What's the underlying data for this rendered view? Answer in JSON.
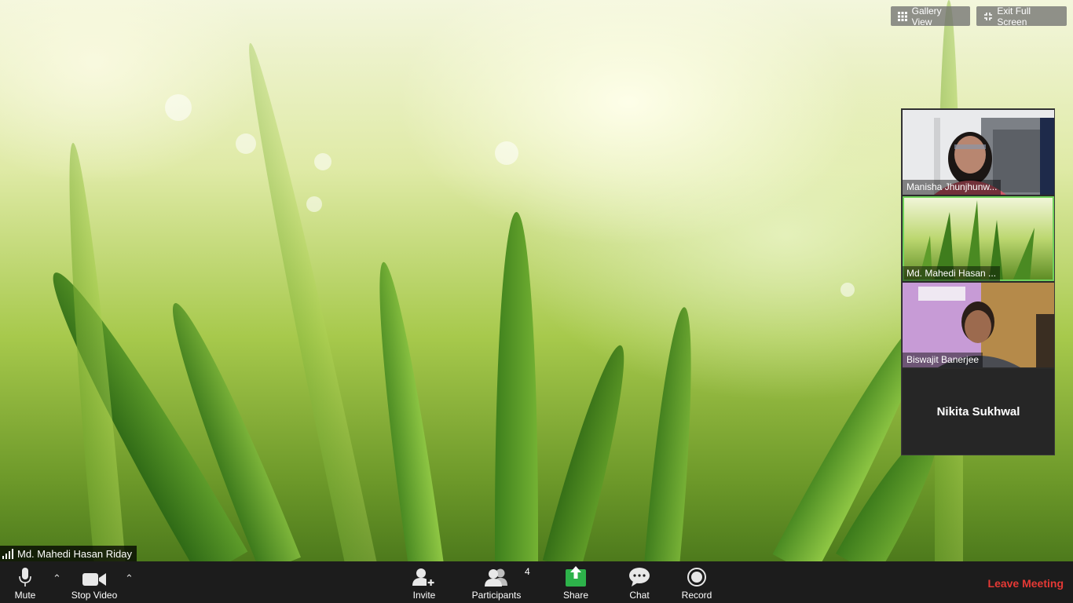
{
  "top_buttons": {
    "gallery_view": "Gallery View",
    "exit_full_screen": "Exit Full Screen"
  },
  "participants_panel": [
    {
      "name": "Manisha Jhunjhunw..."
    },
    {
      "name": "Md. Mahedi Hasan ..."
    },
    {
      "name": "Biswajit Banerjee"
    },
    {
      "name": "Nikita Sukhwal"
    }
  ],
  "active_speaker": {
    "name": "Md. Mahedi Hasan Riday"
  },
  "toolbar": {
    "mute": "Mute",
    "stop_video": "Stop Video",
    "invite": "Invite",
    "participants": "Participants",
    "participants_count": "4",
    "share": "Share",
    "chat": "Chat",
    "record": "Record",
    "leave": "Leave Meeting"
  },
  "colors": {
    "share_green": "#2db24a",
    "leave_red": "#e53935",
    "active_border": "#6fd25a"
  }
}
